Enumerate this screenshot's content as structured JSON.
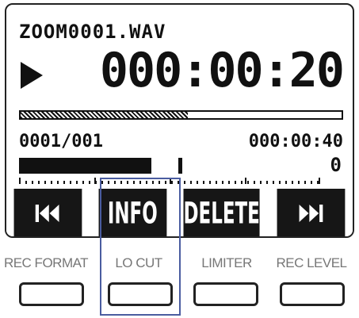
{
  "display": {
    "filename": "ZOOM0001.WAV",
    "counter": "000:00:20",
    "track_number": "0001/001",
    "total_time": "000:00:40",
    "clip_indicator": "0",
    "playback_state_icon": "play-icon",
    "progress_fraction": 0.52,
    "level_fraction": 0.44,
    "peak_hold_fraction": 0.53
  },
  "softkeys": [
    {
      "icon": "skip-back-icon",
      "label": ""
    },
    {
      "icon": "",
      "label": "INFO"
    },
    {
      "icon": "",
      "label": "DELETE"
    },
    {
      "icon": "skip-forward-icon",
      "label": ""
    }
  ],
  "hardware_buttons": [
    {
      "label": "REC FORMAT"
    },
    {
      "label": "LO CUT"
    },
    {
      "label": "LIMITER"
    },
    {
      "label": "REC LEVEL"
    }
  ],
  "colors": {
    "lcd_ink": "#111111",
    "lcd_background": "#ffffff",
    "button_label_gray": "#777777",
    "highlight_blue": "#4a5ca0"
  }
}
